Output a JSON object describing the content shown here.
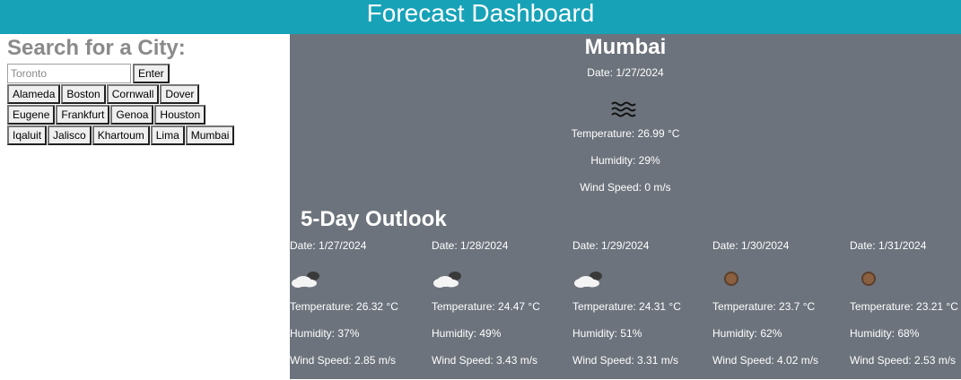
{
  "header": {
    "title": "Forecast Dashboard"
  },
  "search": {
    "title": "Search for a City:",
    "placeholder": "Toronto",
    "value": "",
    "button_label": "Enter"
  },
  "history": [
    "Alameda",
    "Boston",
    "Cornwall",
    "Dover",
    "Eugene",
    "Frankfurt",
    "Genoa",
    "Houston",
    "Iqaluit",
    "Jalisco",
    "Khartoum",
    "Lima",
    "Mumbai"
  ],
  "current": {
    "city": "Mumbai",
    "date": "Date: 1/27/2024",
    "icon": "haze-icon",
    "temperature": "Temperature: 26.99 °C",
    "humidity": "Humidity: 29%",
    "wind": "Wind Speed: 0 m/s"
  },
  "outlook": {
    "title": "5-Day Outlook",
    "days": [
      {
        "date": "Date: 1/27/2024",
        "icon": "few-clouds-icon",
        "temperature": "Temperature: 26.32 °C",
        "humidity": "Humidity: 37%",
        "wind": "Wind Speed: 2.85 m/s"
      },
      {
        "date": "Date: 1/28/2024",
        "icon": "few-clouds-icon",
        "temperature": "Temperature: 24.47 °C",
        "humidity": "Humidity: 49%",
        "wind": "Wind Speed: 3.43 m/s"
      },
      {
        "date": "Date: 1/29/2024",
        "icon": "few-clouds-icon",
        "temperature": "Temperature: 24.31 °C",
        "humidity": "Humidity: 51%",
        "wind": "Wind Speed: 3.31 m/s"
      },
      {
        "date": "Date: 1/30/2024",
        "icon": "clear-sky-icon",
        "temperature": "Temperature: 23.7 °C",
        "humidity": "Humidity: 62%",
        "wind": "Wind Speed: 4.02 m/s"
      },
      {
        "date": "Date: 1/31/2024",
        "icon": "clear-sky-icon",
        "temperature": "Temperature: 23.21 °C",
        "humidity": "Humidity: 68%",
        "wind": "Wind Speed: 2.53 m/s"
      }
    ]
  },
  "colors": {
    "header": "#17a2b8",
    "panel": "#6c737c",
    "search_title": "#8a8a8a"
  }
}
